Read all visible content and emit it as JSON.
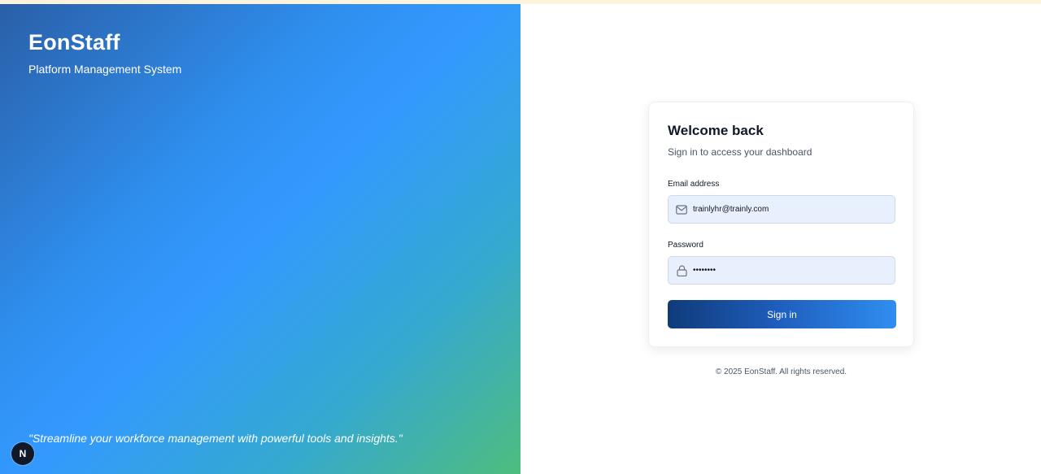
{
  "brand": {
    "title": "EonStaff",
    "subtitle": "Platform Management System",
    "quote": "\"Streamline your workforce management with powerful tools and insights.\""
  },
  "badge": {
    "label": "N"
  },
  "login": {
    "heading": "Welcome back",
    "subheading": "Sign in to access your dashboard",
    "email": {
      "label": "Email address",
      "value": "trainlyhr@trainly.com",
      "icon": "mail-icon"
    },
    "password": {
      "label": "Password",
      "value": "••••••••",
      "icon": "lock-icon"
    },
    "submit_label": "Sign in"
  },
  "footer": {
    "text": "© 2025 EonStaff. All rights reserved."
  },
  "colors": {
    "accent_dark": "#0f3b7a",
    "accent_light": "#2f8ef0",
    "input_bg": "#e8f0fe"
  }
}
